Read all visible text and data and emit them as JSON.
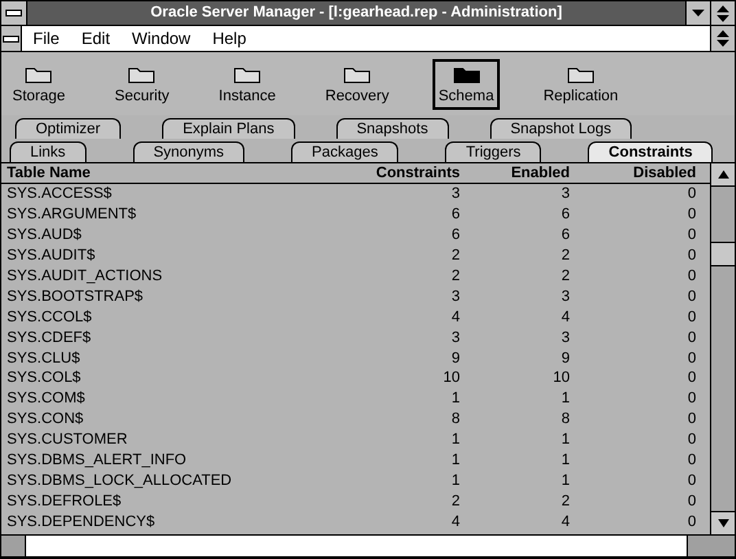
{
  "window": {
    "title": "Oracle Server Manager - [l:gearhead.rep - Administration]"
  },
  "menu": [
    "File",
    "Edit",
    "Window",
    "Help"
  ],
  "toolbar": [
    {
      "label": "Storage",
      "selected": false
    },
    {
      "label": "Security",
      "selected": false
    },
    {
      "label": "Instance",
      "selected": false
    },
    {
      "label": "Recovery",
      "selected": false
    },
    {
      "label": "Schema",
      "selected": true
    },
    {
      "label": "Replication",
      "selected": false
    }
  ],
  "tabs_back": [
    {
      "label": "Optimizer",
      "selected": false
    },
    {
      "label": "Explain Plans",
      "selected": false
    },
    {
      "label": "Snapshots",
      "selected": false
    },
    {
      "label": "Snapshot Logs",
      "selected": false
    }
  ],
  "tabs_front": [
    {
      "label": "Links",
      "selected": false
    },
    {
      "label": "Synonyms",
      "selected": false
    },
    {
      "label": "Packages",
      "selected": false
    },
    {
      "label": "Triggers",
      "selected": false
    },
    {
      "label": "Constraints",
      "selected": true
    }
  ],
  "table": {
    "columns": [
      "Table Name",
      "Constraints",
      "Enabled",
      "Disabled"
    ],
    "rows": [
      [
        "SYS.ACCESS$",
        "3",
        "3",
        "0"
      ],
      [
        "SYS.ARGUMENT$",
        "6",
        "6",
        "0"
      ],
      [
        "SYS.AUD$",
        "6",
        "6",
        "0"
      ],
      [
        "SYS.AUDIT$",
        "2",
        "2",
        "0"
      ],
      [
        "SYS.AUDIT_ACTIONS",
        "2",
        "2",
        "0"
      ],
      [
        "SYS.BOOTSTRAP$",
        "3",
        "3",
        "0"
      ],
      [
        "SYS.CCOL$",
        "4",
        "4",
        "0"
      ],
      [
        "SYS.CDEF$",
        "3",
        "3",
        "0"
      ],
      [
        "SYS.CLU$",
        "9",
        "9",
        "0"
      ],
      [
        "SYS.COL$",
        "10",
        "10",
        "0"
      ],
      [
        "SYS.COM$",
        "1",
        "1",
        "0"
      ],
      [
        "SYS.CON$",
        "8",
        "8",
        "0"
      ],
      [
        "SYS.CUSTOMER",
        "1",
        "1",
        "0"
      ],
      [
        "SYS.DBMS_ALERT_INFO",
        "1",
        "1",
        "0"
      ],
      [
        "SYS.DBMS_LOCK_ALLOCATED",
        "1",
        "1",
        "0"
      ],
      [
        "SYS.DEFROLE$",
        "2",
        "2",
        "0"
      ],
      [
        "SYS.DEPENDENCY$",
        "4",
        "4",
        "0"
      ]
    ]
  }
}
